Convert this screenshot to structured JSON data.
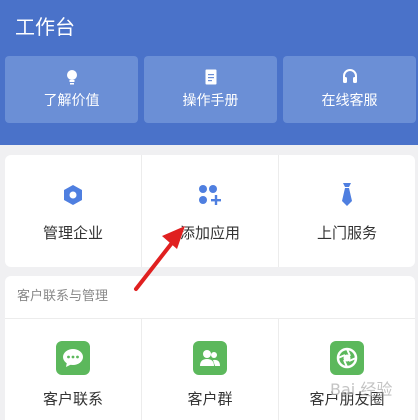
{
  "header": {
    "title": "工作台",
    "quick_actions": [
      {
        "label": "了解价值",
        "icon": "lightbulb-icon"
      },
      {
        "label": "操作手册",
        "icon": "document-icon"
      },
      {
        "label": "在线客服",
        "icon": "headset-icon"
      }
    ]
  },
  "main_grid": [
    {
      "label": "管理企业",
      "icon": "hexagon-icon"
    },
    {
      "label": "添加应用",
      "icon": "add-apps-icon"
    },
    {
      "label": "上门服务",
      "icon": "necktie-icon"
    }
  ],
  "customer_section": {
    "title": "客户联系与管理",
    "items": [
      {
        "label": "客户联系",
        "icon": "chat-bubble-icon"
      },
      {
        "label": "客户群",
        "icon": "group-icon"
      },
      {
        "label": "客户朋友圈",
        "icon": "camera-aperture-icon"
      }
    ]
  },
  "colors": {
    "header_bg": "#4a72c9",
    "accent_blue": "#4f7fe0",
    "green": "#5cb85c",
    "arrow": "#e02020"
  },
  "watermark": "Bai 经验"
}
